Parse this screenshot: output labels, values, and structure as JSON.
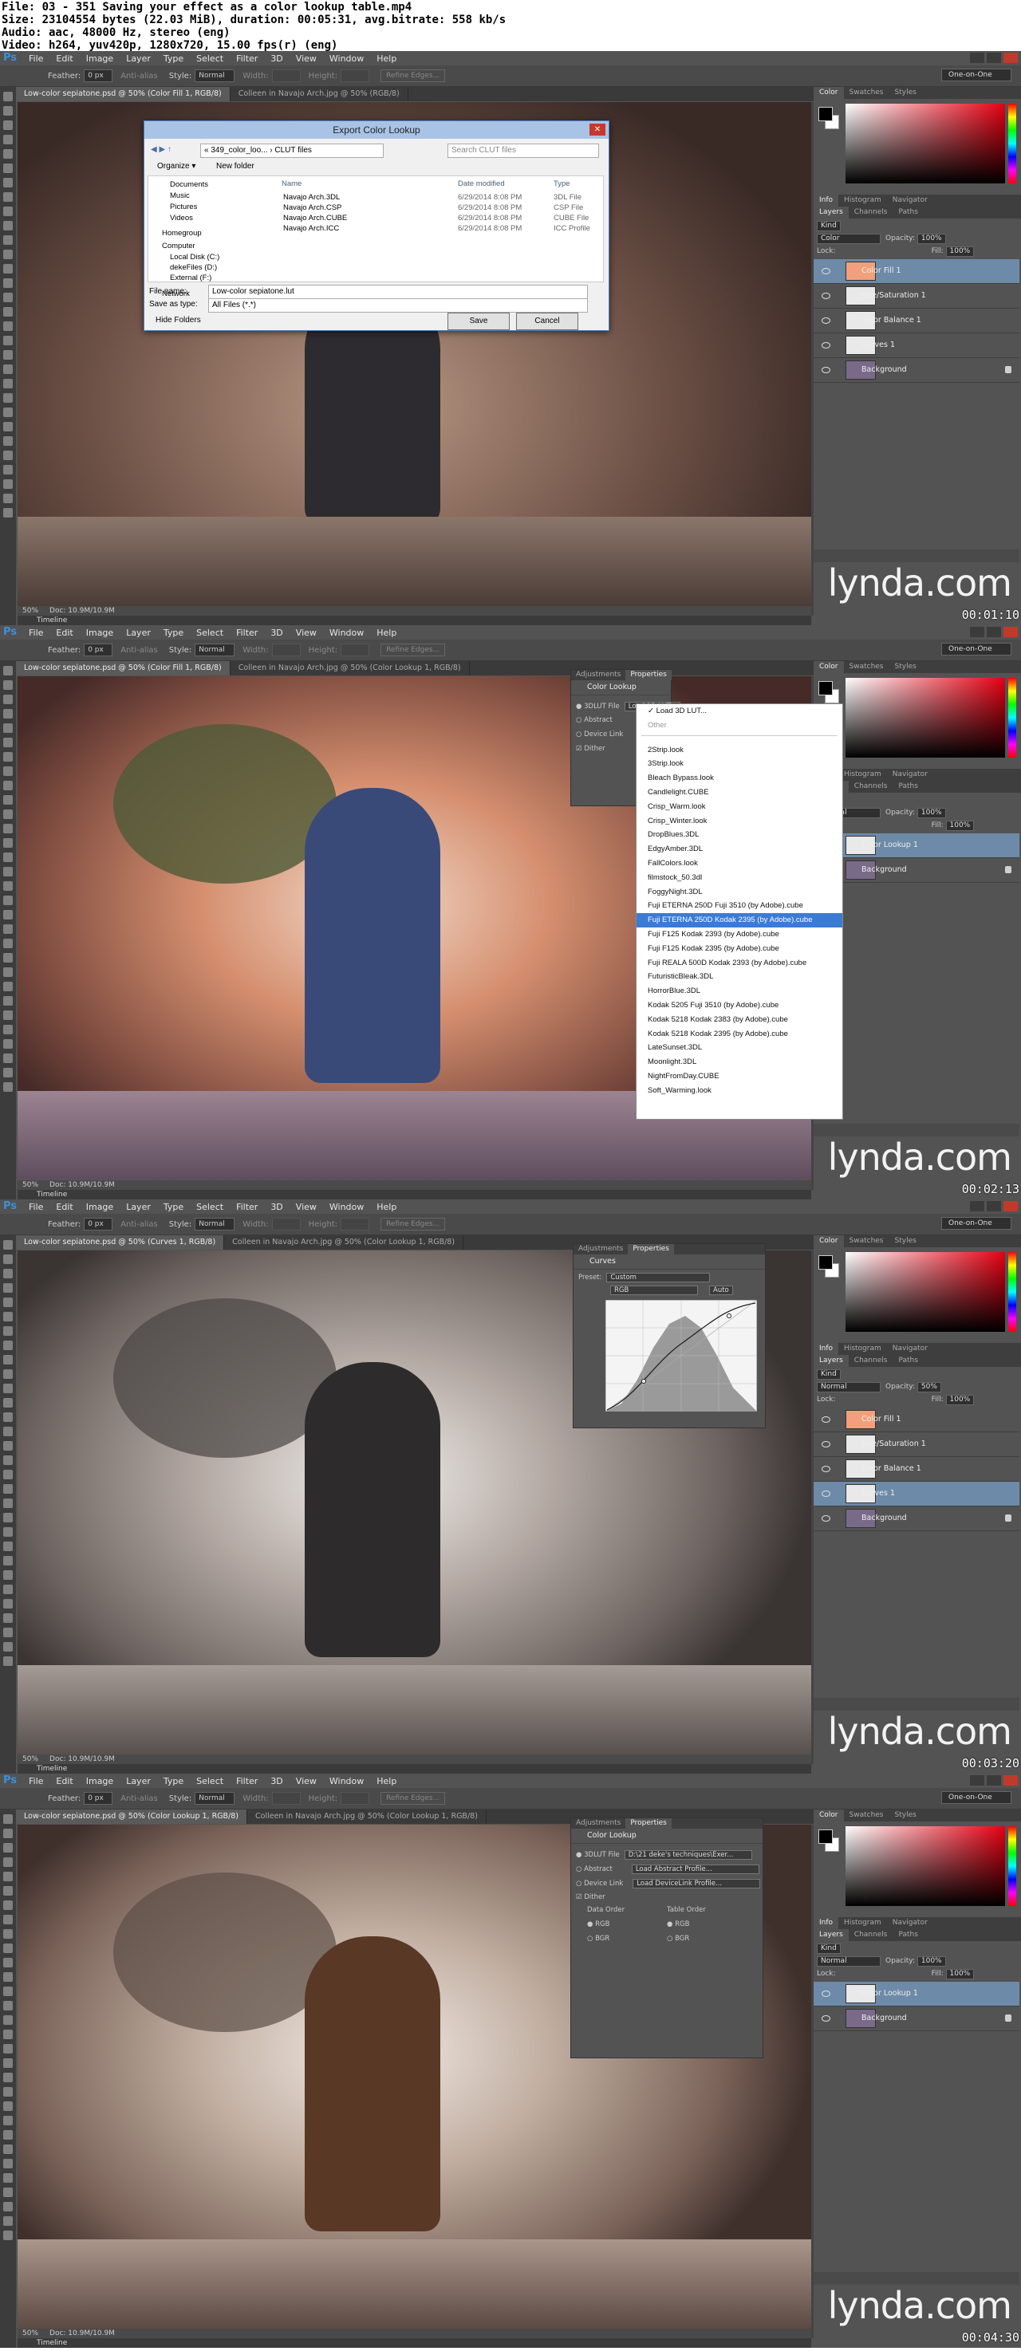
{
  "header": {
    "line1": "File: 03 - 351 Saving your effect as a color lookup table.mp4",
    "line2": "Size: 23104554 bytes (22.03 MiB), duration: 00:05:31, avg.bitrate: 558 kb/s",
    "line3": "Audio: aac, 48000 Hz, stereo (eng)",
    "line4": "Video: h264, yuv420p, 1280x720, 15.00 fps(r) (eng)"
  },
  "menu": [
    "File",
    "Edit",
    "Image",
    "Layer",
    "Type",
    "Select",
    "Filter",
    "3D",
    "View",
    "Window",
    "Help"
  ],
  "options": {
    "feather_label": "Feather:",
    "feather_value": "0 px",
    "antialias": "Anti-alias",
    "style_label": "Style:",
    "style_value": "Normal",
    "width_label": "Width:",
    "height_label": "Height:",
    "refine": "Refine Edges...",
    "workspace": "One-on-One"
  },
  "color_tabs": [
    "Color",
    "Swatches",
    "Styles"
  ],
  "info_tabs": [
    "Info",
    "Histogram",
    "Navigator"
  ],
  "layer_tabs": [
    "Layers",
    "Channels",
    "Paths"
  ],
  "layers_controls": {
    "kind": "Kind",
    "opacity_label": "Opacity:",
    "opacity_100": "100%",
    "opacity_50": "50%",
    "fill_label": "Fill:",
    "fill_value": "100%",
    "lock_label": "Lock:",
    "mode_color": "Color",
    "mode_normal": "Normal"
  },
  "brand": "lynda.com",
  "statusbar": {
    "zoom": "50%",
    "doc": "Doc: 10.9M/10.9M"
  },
  "timeline": "Timeline",
  "frames": [
    {
      "timecode": "00:01:10",
      "tabs": [
        "Low-color sepiatone.psd @ 50% (Color Fill 1, RGB/8)",
        "Colleen in Navajo Arch.jpg @ 50% (RGB/8)"
      ],
      "layers": [
        {
          "name": "Color Fill 1",
          "selected": true,
          "swatch": "#f2a07b"
        },
        {
          "name": "Hue/Saturation 1",
          "selected": false
        },
        {
          "name": "Color Balance 1",
          "selected": false
        },
        {
          "name": "Curves 1",
          "selected": false
        },
        {
          "name": "Background",
          "selected": false
        }
      ],
      "dialog": {
        "title": "Export Color Lookup",
        "path": "« 349_color_loo... › CLUT files",
        "search_placeholder": "Search CLUT files",
        "organize": "Organize ▾",
        "new_folder": "New folder",
        "columns": [
          "Name",
          "Date modified",
          "Type"
        ],
        "files": [
          {
            "name": "Navajo Arch.3DL",
            "date": "6/29/2014 8:08 PM",
            "type": "3DL File"
          },
          {
            "name": "Navajo Arch.CSP",
            "date": "6/29/2014 8:08 PM",
            "type": "CSP File"
          },
          {
            "name": "Navajo Arch.CUBE",
            "date": "6/29/2014 8:08 PM",
            "type": "CUBE File"
          },
          {
            "name": "Navajo Arch.ICC",
            "date": "6/29/2014 8:08 PM",
            "type": "ICC Profile"
          }
        ],
        "nav": [
          "Documents",
          "Music",
          "Pictures",
          "Videos",
          "Homegroup",
          "Computer",
          "Local Disk (C:)",
          "dekeFiles (D:)",
          "External (F:)",
          "Network"
        ],
        "filename_label": "File name:",
        "filename_value": "Low-color sepiatone.lut",
        "savetype_label": "Save as type:",
        "savetype_value": "All Files (*.*)",
        "hide_folders": "Hide Folders",
        "save": "Save",
        "cancel": "Cancel"
      }
    },
    {
      "timecode": "00:02:13",
      "tabs": [
        "Low-color sepiatone.psd @ 50% (Color Fill 1, RGB/8)",
        "Colleen in Navajo Arch.jpg @ 50% (Color Lookup 1, RGB/8)"
      ],
      "layers": [
        {
          "name": "Color Lookup 1",
          "selected": true
        },
        {
          "name": "Background",
          "selected": false
        }
      ],
      "props": {
        "tabs": [
          "Adjustments",
          "Properties"
        ],
        "title": "Color Lookup",
        "lut_label": "3DLUT File",
        "lut_value": "Load 3D LUT...",
        "abstract": "Abstract",
        "device_link": "Device Link",
        "dither": "Dither"
      },
      "lut_menu": {
        "checked": "Load 3D LUT...",
        "other": "Other",
        "highlighted": "Fuji ETERNA 250D Kodak 2395 (by Adobe).cube",
        "items": [
          "2Strip.look",
          "3Strip.look",
          "Bleach Bypass.look",
          "Candlelight.CUBE",
          "Crisp_Warm.look",
          "Crisp_Winter.look",
          "DropBlues.3DL",
          "EdgyAmber.3DL",
          "FallColors.look",
          "filmstock_50.3dl",
          "FoggyNight.3DL",
          "Fuji ETERNA 250D Fuji 3510 (by Adobe).cube",
          "Fuji ETERNA 250D Kodak 2395 (by Adobe).cube",
          "Fuji F125 Kodak 2393 (by Adobe).cube",
          "Fuji F125 Kodak 2395 (by Adobe).cube",
          "Fuji REALA 500D Kodak 2393 (by Adobe).cube",
          "FuturisticBleak.3DL",
          "HorrorBlue.3DL",
          "Kodak 5205 Fuji 3510 (by Adobe).cube",
          "Kodak 5218 Kodak 2383 (by Adobe).cube",
          "Kodak 5218 Kodak 2395 (by Adobe).cube",
          "LateSunset.3DL",
          "Moonlight.3DL",
          "NightFromDay.CUBE",
          "Soft_Warming.look"
        ]
      }
    },
    {
      "timecode": "00:03:20",
      "tabs": [
        "Low-color sepiatone.psd @ 50% (Curves 1, RGB/8)",
        "Colleen in Navajo Arch.jpg @ 50% (Color Lookup 1, RGB/8)"
      ],
      "layers": [
        {
          "name": "Color Fill 1",
          "selected": false,
          "swatch": "#f2a07b"
        },
        {
          "name": "Hue/Saturation 1",
          "selected": false
        },
        {
          "name": "Color Balance 1",
          "selected": false
        },
        {
          "name": "Curves 1",
          "selected": true
        },
        {
          "name": "Background",
          "selected": false
        }
      ],
      "props": {
        "tabs": [
          "Adjustments",
          "Properties"
        ],
        "title": "Curves",
        "preset_label": "Preset:",
        "preset_value": "Custom",
        "channel_value": "RGB",
        "auto": "Auto"
      }
    },
    {
      "timecode": "00:04:30",
      "tabs": [
        "Low-color sepiatone.psd @ 50% (Color Lookup 1, RGB/8)",
        "Colleen in Navajo Arch.jpg @ 50% (Color Lookup 1, RGB/8)"
      ],
      "layers": [
        {
          "name": "Color Lookup 1",
          "selected": true
        },
        {
          "name": "Background",
          "selected": false
        }
      ],
      "props": {
        "tabs": [
          "Adjustments",
          "Properties"
        ],
        "title": "Color Lookup",
        "lut_label": "3DLUT File",
        "lut_value": "D:\\21 deke's techniques\\Exer...",
        "abstract": "Abstract",
        "abstract_value": "Load Abstract Profile...",
        "device_link": "Device Link",
        "device_value": "Load DeviceLink Profile...",
        "dither": "Dither",
        "data_order": "Data Order",
        "table_order": "Table Order",
        "rgb": "RGB",
        "bgr": "BGR"
      }
    }
  ]
}
